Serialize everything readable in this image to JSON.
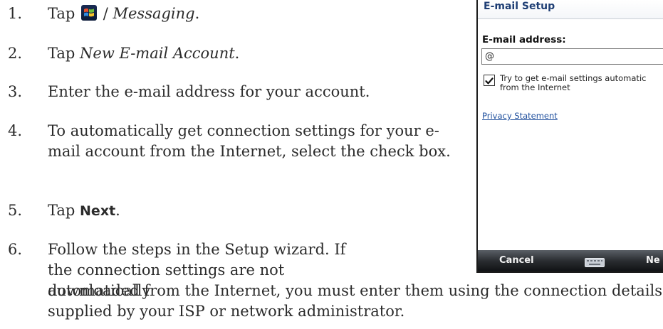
{
  "steps": [
    {
      "num": "1.",
      "pre": "Tap",
      "post": "/",
      "italic": "Messaging",
      "end": "."
    },
    {
      "num": "2.",
      "pre": "Tap",
      "italic": "New E-mail Account",
      "end": "."
    },
    {
      "num": "3.",
      "text": "Enter the e-mail address for your account."
    },
    {
      "num": "4.",
      "text": "To automatically get connection settings for your e-mail account from the Internet, select the check box."
    },
    {
      "num": "5.",
      "pre": "Tap",
      "bold": "Next",
      "end": "."
    },
    {
      "num": "6.",
      "text": "Follow the steps in the Setup wizard. If the connection settings are not automatically",
      "text_cont": "downloaded from the Internet, you must enter them using the connection details supplied by your ISP or network administrator."
    }
  ],
  "icons": {
    "start": "windows-start-icon",
    "keyboard": "keyboard-icon",
    "checkmark": "checkmark-icon"
  },
  "phone": {
    "title": "E-mail Setup",
    "field_label": "E-mail address:",
    "email_value": "@",
    "checkbox_checked": true,
    "checkbox_label_1": "Try to get e-mail settings automatic",
    "checkbox_label_2": "from the Internet",
    "privacy_link": "Privacy Statement",
    "softkey_left": "Cancel",
    "softkey_right": "Ne"
  },
  "colors": {
    "phone_title": "#1e3e74",
    "link": "#1f4f9d",
    "softbar": "#2a2d31"
  }
}
